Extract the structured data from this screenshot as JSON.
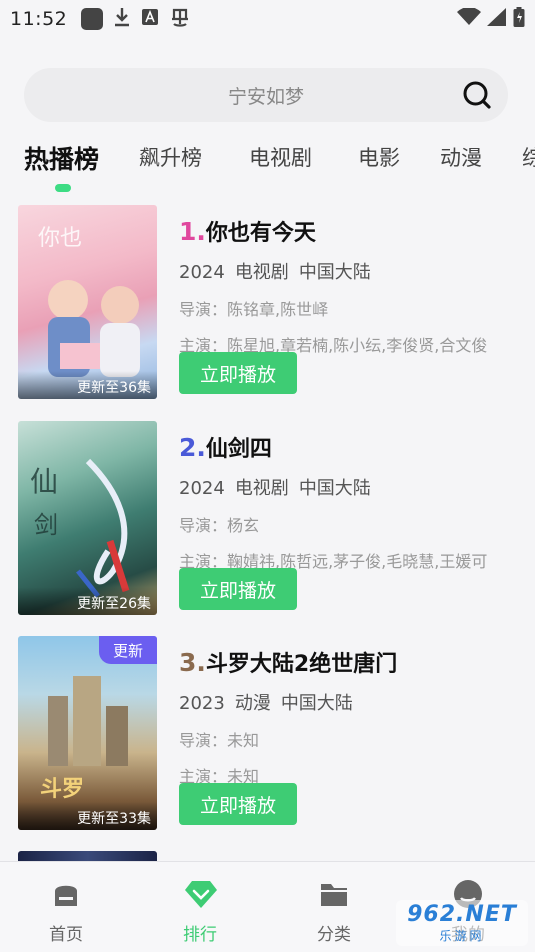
{
  "status_bar": {
    "time": "11:52",
    "icons_left": [
      "app-square-icon",
      "download-icon",
      "font-a-icon",
      "bug-icon"
    ],
    "icons_right": [
      "wifi-icon",
      "signal-icon",
      "battery-icon"
    ]
  },
  "search": {
    "placeholder": "宁安如梦"
  },
  "tabs": [
    {
      "label": "热播榜",
      "active": true
    },
    {
      "label": "飙升榜",
      "active": false
    },
    {
      "label": "电视剧",
      "active": false
    },
    {
      "label": "电影",
      "active": false
    },
    {
      "label": "动漫",
      "active": false
    },
    {
      "label": "综",
      "active": false
    }
  ],
  "items": [
    {
      "rank": "1.",
      "rank_color": "#e0479e",
      "title": "你也有今天",
      "year": "2024",
      "category": "电视剧",
      "region": "中国大陆",
      "director": "导演：陈铭章,陈世峄",
      "cast": "主演：陈星旭,章若楠,陈小纭,李俊贤,合文俊",
      "poster_caption": "更新至36集",
      "play_label": "立即播放",
      "badge": ""
    },
    {
      "rank": "2.",
      "rank_color": "#4a5ad8",
      "title": "仙剑四",
      "year": "2024",
      "category": "电视剧",
      "region": "中国大陆",
      "director": "导演：杨玄",
      "cast": "主演：鞠婧祎,陈哲远,茅子俊,毛晓慧,王媛可",
      "poster_caption": "更新至26集",
      "play_label": "立即播放",
      "badge": ""
    },
    {
      "rank": "3.",
      "rank_color": "#8a6a4e",
      "title": "斗罗大陆2绝世唐门",
      "year": "2023",
      "category": "动漫",
      "region": "中国大陆",
      "director": "导演：未知",
      "cast": "主演：未知",
      "poster_caption": "更新至33集",
      "play_label": "立即播放",
      "badge": "更新"
    }
  ],
  "bottom_nav": [
    {
      "label": "首页",
      "icon": "home-icon",
      "active": false
    },
    {
      "label": "排行",
      "icon": "ranking-diamond-icon",
      "active": true
    },
    {
      "label": "分类",
      "icon": "folder-icon",
      "active": false
    },
    {
      "label": "我的",
      "icon": "profile-icon",
      "active": false
    }
  ],
  "watermark": {
    "top": "962.NET",
    "bottom": "乐游网"
  },
  "colors": {
    "accent": "#3ecc74",
    "badge": "#6b5ef0"
  }
}
